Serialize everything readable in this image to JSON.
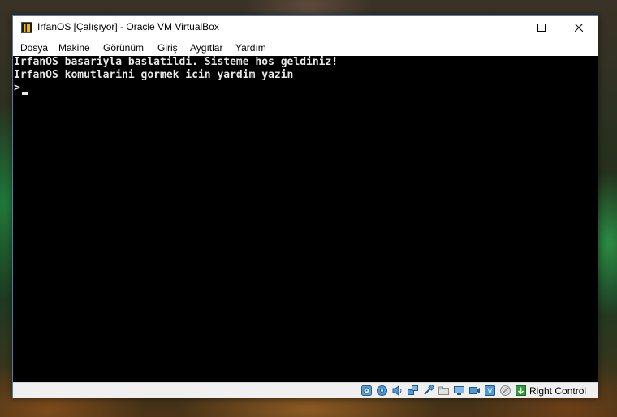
{
  "window": {
    "title": "IrfanOS [Çalışıyor] - Oracle VM VirtualBox",
    "app_icon": "virtualbox-icon",
    "controls": {
      "minimize": "minimize-icon",
      "maximize": "maximize-icon",
      "close": "close-icon"
    }
  },
  "menu": {
    "items": [
      "Dosya",
      "Makine",
      "Görünüm",
      "Giriş",
      "Aygıtlar",
      "Yardım"
    ]
  },
  "console": {
    "lines": [
      "IrfanOS basariyla baslatildi. Sisteme hos geldiniz!",
      "IrfanOS komutlarini gormek icin yardim yazin",
      ">"
    ]
  },
  "statusbar": {
    "icons": [
      "hard-disk-icon",
      "optical-drive-icon",
      "audio-icon",
      "network-icon",
      "usb-icon",
      "shared-folders-icon",
      "display-icon",
      "recording-icon",
      "virtualization-icon",
      "mouse-integration-icon",
      "keyboard-capture-icon"
    ],
    "host_key": "Right Control"
  },
  "colors": {
    "console_bg": "#000000",
    "console_fg": "#e8e8e8",
    "window_border": "#4d7bb3"
  }
}
